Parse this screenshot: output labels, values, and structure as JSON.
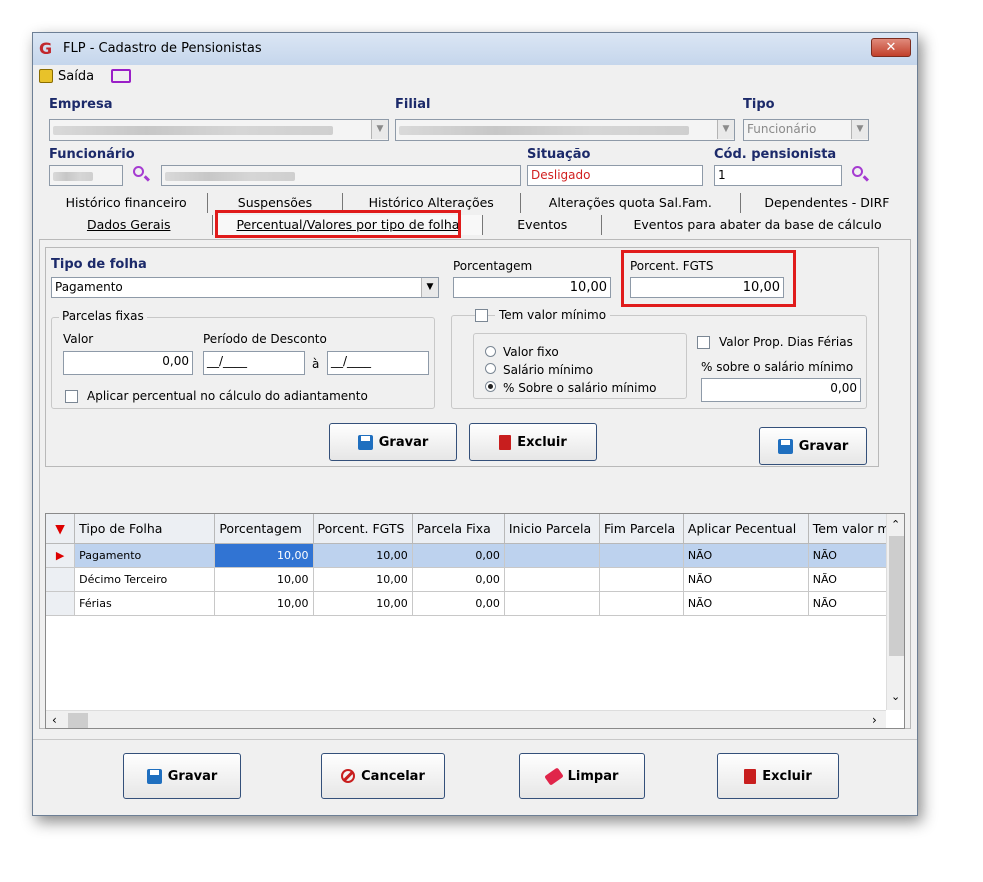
{
  "window": {
    "title": "FLP - Cadastro de Pensionistas",
    "logo_letter": "G"
  },
  "menu": {
    "exit_label": "Saída"
  },
  "header": {
    "empresa_label": "Empresa",
    "filial_label": "Filial",
    "tipo_label": "Tipo",
    "tipo_value": "Funcionário",
    "funcionario_label": "Funcionário",
    "situacao_label": "Situação",
    "situacao_value": "Desligado",
    "cod_pensionista_label": "Cód. pensionista",
    "cod_pensionista_value": "1"
  },
  "tabs_row1": [
    "Histórico financeiro",
    "Suspensões",
    "Histórico Alterações",
    "Alterações quota Sal.Fam.",
    "Dependentes - DIRF"
  ],
  "tabs_row2": [
    "Dados Gerais",
    "Percentual/Valores por tipo de folha",
    "Eventos",
    "Eventos para abater da base de cálculo"
  ],
  "form": {
    "tipo_folha_label": "Tipo de folha",
    "tipo_folha_value": "Pagamento",
    "porcentagem_label": "Porcentagem",
    "porcentagem_value": "10,00",
    "porcent_fgts_label": "Porcent. FGTS",
    "porcent_fgts_value": "10,00",
    "parcelas_fixas_label": "Parcelas fixas",
    "valor_label": "Valor",
    "valor_value": "0,00",
    "periodo_label": "Período de Desconto",
    "periodo_from": "__/____",
    "periodo_sep": "à",
    "periodo_to": "__/____",
    "aplicar_label": "Aplicar percentual no cálculo do adiantamento",
    "tem_valor_minimo_label": "Tem valor mínimo",
    "radio_valor_fixo": "Valor fixo",
    "radio_salario_minimo": "Salário mínimo",
    "radio_pct_salario": "% Sobre o salário mínimo",
    "valor_prop_label": "Valor Prop. Dias Férias",
    "pct_sobre_label": "% sobre o salário mínimo",
    "pct_sobre_value": "0,00",
    "gravar_label": "Gravar",
    "excluir_label": "Excluir",
    "gravar2_label": "Gravar"
  },
  "grid": {
    "columns": [
      "Tipo de Folha",
      "Porcentagem",
      "Porcent. FGTS",
      "Parcela Fixa",
      "Inicio Parcela",
      "Fim Parcela",
      "Aplicar Pecentual",
      "Tem valor mín"
    ],
    "rows": [
      [
        "Pagamento",
        "10,00",
        "10,00",
        "0,00",
        "",
        "",
        "NÃO",
        "NÃO"
      ],
      [
        "Décimo Terceiro",
        "10,00",
        "10,00",
        "0,00",
        "",
        "",
        "NÃO",
        "NÃO"
      ],
      [
        "Férias",
        "10,00",
        "10,00",
        "0,00",
        "",
        "",
        "NÃO",
        "NÃO"
      ]
    ]
  },
  "footer": {
    "gravar": "Gravar",
    "cancelar": "Cancelar",
    "limpar": "Limpar",
    "excluir": "Excluir"
  }
}
